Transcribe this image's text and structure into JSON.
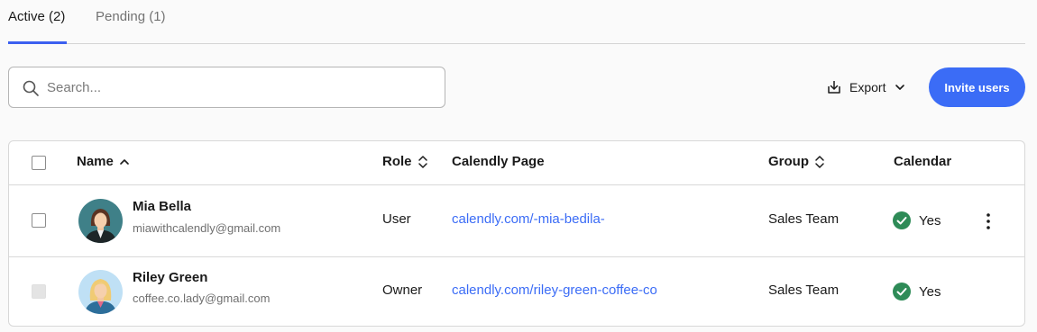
{
  "tabs": [
    {
      "label": "Active (2)",
      "active": true
    },
    {
      "label": "Pending (1)",
      "active": false
    }
  ],
  "search": {
    "placeholder": "Search...",
    "value": ""
  },
  "toolbar": {
    "export_label": "Export",
    "invite_label": "Invite users"
  },
  "table": {
    "columns": {
      "name": "Name",
      "role": "Role",
      "page": "Calendly Page",
      "group": "Group",
      "calendar": "Calendar"
    },
    "rows": [
      {
        "name": "Mia Bella",
        "email": "miawithcalendly@gmail.com",
        "role": "User",
        "page": "calendly.com/-mia-bedila-",
        "group": "Sales Team",
        "calendar": "Yes"
      },
      {
        "name": "Riley Green",
        "email": "coffee.co.lady@gmail.com",
        "role": "Owner",
        "page": "calendly.com/riley-green-coffee-co",
        "group": "Sales Team",
        "calendar": "Yes"
      }
    ]
  },
  "colors": {
    "accent": "#3b6cf6",
    "check_green": "#2e8b57"
  },
  "icons": [
    "search-icon",
    "export-icon",
    "chevron-down-icon",
    "sort-ascending-icon",
    "sort-both-icon",
    "check-circle-icon",
    "more-vertical-icon"
  ]
}
